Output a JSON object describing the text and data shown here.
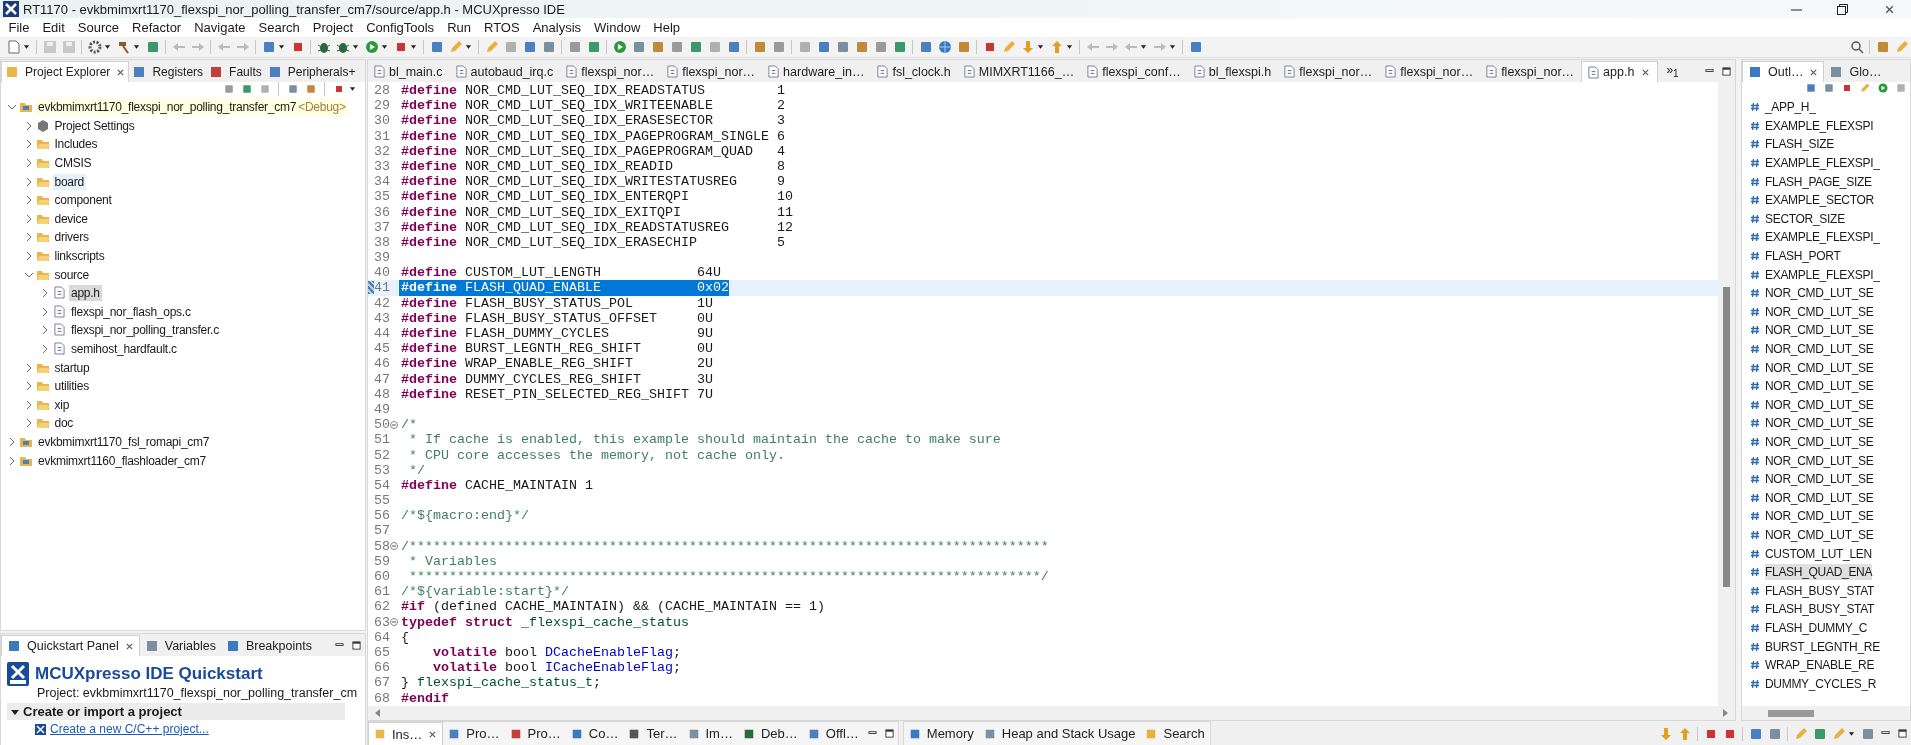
{
  "window": {
    "title": "RT1170 - evkbmimxrt1170_flexspi_nor_polling_transfer_cm7/source/app.h - MCUXpresso IDE"
  },
  "menu": [
    "File",
    "Edit",
    "Source",
    "Refactor",
    "Navigate",
    "Search",
    "Project",
    "ConfigTools",
    "Run",
    "RTOS",
    "Analysis",
    "Window",
    "Help"
  ],
  "explorer": {
    "tabs": [
      {
        "label": "Project Explorer",
        "selected": true
      },
      {
        "label": "Registers",
        "selected": false
      },
      {
        "label": "Faults",
        "selected": false
      },
      {
        "label": "Peripherals+",
        "selected": false
      }
    ],
    "tree": [
      {
        "kind": "project",
        "label": "evkbmimxrt1170_flexspi_nor_polling_transfer_cm7",
        "suffix": "<Debug>",
        "active": true,
        "expanded": true,
        "selected": false,
        "hovered": false,
        "children": [
          {
            "kind": "settings",
            "label": "Project Settings",
            "expanded": false,
            "selected": false,
            "hovered": false
          },
          {
            "kind": "folder",
            "label": "Includes",
            "expanded": false,
            "selected": false,
            "hovered": false
          },
          {
            "kind": "folder",
            "label": "CMSIS",
            "expanded": false,
            "selected": false,
            "hovered": false
          },
          {
            "kind": "folder",
            "label": "board",
            "expanded": false,
            "selected": false,
            "hovered": true
          },
          {
            "kind": "folder",
            "label": "component",
            "expanded": false,
            "selected": false,
            "hovered": false
          },
          {
            "kind": "folder",
            "label": "device",
            "expanded": false,
            "selected": false,
            "hovered": false
          },
          {
            "kind": "folder",
            "label": "drivers",
            "expanded": false,
            "selected": false,
            "hovered": false
          },
          {
            "kind": "folder",
            "label": "linkscripts",
            "expanded": false,
            "selected": false,
            "hovered": false
          },
          {
            "kind": "folder",
            "label": "source",
            "expanded": true,
            "selected": false,
            "hovered": false,
            "children": [
              {
                "kind": "file",
                "label": "app.h",
                "expanded": false,
                "selected": true,
                "hovered": false
              },
              {
                "kind": "file",
                "label": "flexspi_nor_flash_ops.c",
                "expanded": false,
                "selected": false,
                "hovered": false
              },
              {
                "kind": "file",
                "label": "flexspi_nor_polling_transfer.c",
                "expanded": false,
                "selected": false,
                "hovered": false
              },
              {
                "kind": "file",
                "label": "semihost_hardfault.c",
                "expanded": false,
                "selected": false,
                "hovered": false
              }
            ]
          },
          {
            "kind": "folder",
            "label": "startup",
            "expanded": false,
            "selected": false,
            "hovered": false
          },
          {
            "kind": "folder",
            "label": "utilities",
            "expanded": false,
            "selected": false,
            "hovered": false
          },
          {
            "kind": "folder",
            "label": "xip",
            "expanded": false,
            "selected": false,
            "hovered": false
          },
          {
            "kind": "folder",
            "label": "doc",
            "expanded": false,
            "selected": false,
            "hovered": false
          }
        ]
      },
      {
        "kind": "project",
        "label": "evkbmimxrt1170_fsl_romapi_cm7",
        "active": false,
        "expanded": false,
        "selected": false,
        "hovered": false
      },
      {
        "kind": "project",
        "label": "evkmimxrt1160_flashloader_cm7",
        "active": false,
        "expanded": false,
        "selected": false,
        "hovered": false
      }
    ]
  },
  "quickstart": {
    "tabs": [
      {
        "label": "Quickstart Panel",
        "selected": true
      },
      {
        "label": "Variables",
        "selected": false
      },
      {
        "label": "Breakpoints",
        "selected": false
      }
    ],
    "title": "MCUXpresso IDE Quickstart",
    "project": "Project: evkbmimxrt1170_flexspi_nor_polling_transfer_cm",
    "section": {
      "label": "Create or import a project",
      "expanded": true
    },
    "links": [
      "Create a new C/C++ project..."
    ]
  },
  "editor": {
    "tabs": [
      {
        "label": "bl_main.c",
        "selected": false
      },
      {
        "label": "autobaud_irq.c",
        "selected": false
      },
      {
        "label": "flexspi_nor…",
        "selected": false
      },
      {
        "label": "flexspi_nor…",
        "selected": false
      },
      {
        "label": "hardware_in…",
        "selected": false
      },
      {
        "label": "fsl_clock.h",
        "selected": false
      },
      {
        "label": "MIMXRT1166_…",
        "selected": false
      },
      {
        "label": "flexspi_conf…",
        "selected": false
      },
      {
        "label": "bl_flexspi.h",
        "selected": false
      },
      {
        "label": "flexspi_nor…",
        "selected": false
      },
      {
        "label": "flexspi_nor…",
        "selected": false
      },
      {
        "label": "flexspi_nor…",
        "selected": false
      },
      {
        "label": "app.h",
        "selected": true
      }
    ],
    "overflow": "»$_{1}$",
    "lines": [
      {
        "number": "28",
        "fold": false,
        "selected": false,
        "tokens": [
          {
            "kind": "keyword",
            "text": "#define"
          },
          {
            "kind": "plain",
            "text": " NOR_CMD_LUT_SEQ_IDX_READSTATUS         1"
          }
        ]
      },
      {
        "number": "29",
        "fold": false,
        "selected": false,
        "tokens": [
          {
            "kind": "keyword",
            "text": "#define"
          },
          {
            "kind": "plain",
            "text": " NOR_CMD_LUT_SEQ_IDX_WRITEENABLE        2"
          }
        ]
      },
      {
        "number": "30",
        "fold": false,
        "selected": false,
        "tokens": [
          {
            "kind": "keyword",
            "text": "#define"
          },
          {
            "kind": "plain",
            "text": " NOR_CMD_LUT_SEQ_IDX_ERASESECTOR        3"
          }
        ]
      },
      {
        "number": "31",
        "fold": false,
        "selected": false,
        "tokens": [
          {
            "kind": "keyword",
            "text": "#define"
          },
          {
            "kind": "plain",
            "text": " NOR_CMD_LUT_SEQ_IDX_PAGEPROGRAM_SINGLE 6"
          }
        ]
      },
      {
        "number": "32",
        "fold": false,
        "selected": false,
        "tokens": [
          {
            "kind": "keyword",
            "text": "#define"
          },
          {
            "kind": "plain",
            "text": " NOR_CMD_LUT_SEQ_IDX_PAGEPROGRAM_QUAD   4"
          }
        ]
      },
      {
        "number": "33",
        "fold": false,
        "selected": false,
        "tokens": [
          {
            "kind": "keyword",
            "text": "#define"
          },
          {
            "kind": "plain",
            "text": " NOR_CMD_LUT_SEQ_IDX_READID             8"
          }
        ]
      },
      {
        "number": "34",
        "fold": false,
        "selected": false,
        "tokens": [
          {
            "kind": "keyword",
            "text": "#define"
          },
          {
            "kind": "plain",
            "text": " NOR_CMD_LUT_SEQ_IDX_WRITESTATUSREG     9"
          }
        ]
      },
      {
        "number": "35",
        "fold": false,
        "selected": false,
        "tokens": [
          {
            "kind": "keyword",
            "text": "#define"
          },
          {
            "kind": "plain",
            "text": " NOR_CMD_LUT_SEQ_IDX_ENTERQPI           10"
          }
        ]
      },
      {
        "number": "36",
        "fold": false,
        "selected": false,
        "tokens": [
          {
            "kind": "keyword",
            "text": "#define"
          },
          {
            "kind": "plain",
            "text": " NOR_CMD_LUT_SEQ_IDX_EXITQPI            11"
          }
        ]
      },
      {
        "number": "37",
        "fold": false,
        "selected": false,
        "tokens": [
          {
            "kind": "keyword",
            "text": "#define"
          },
          {
            "kind": "plain",
            "text": " NOR_CMD_LUT_SEQ_IDX_READSTATUSREG      12"
          }
        ]
      },
      {
        "number": "38",
        "fold": false,
        "selected": false,
        "tokens": [
          {
            "kind": "keyword",
            "text": "#define"
          },
          {
            "kind": "plain",
            "text": " NOR_CMD_LUT_SEQ_IDX_ERASECHIP          5"
          }
        ]
      },
      {
        "number": "39",
        "fold": false,
        "selected": false
      },
      {
        "number": "40",
        "fold": false,
        "selected": false,
        "tokens": [
          {
            "kind": "keyword",
            "text": "#define"
          },
          {
            "kind": "plain",
            "text": " CUSTOM_LUT_LENGTH            64U"
          }
        ]
      },
      {
        "number": "41",
        "fold": false,
        "selected": true,
        "tokens": [
          {
            "kind": "keyword",
            "text": "#define"
          },
          {
            "kind": "plain",
            "text": " FLASH_QUAD_ENABLE            0x02"
          }
        ]
      },
      {
        "number": "42",
        "fold": false,
        "selected": false,
        "tokens": [
          {
            "kind": "keyword",
            "text": "#define"
          },
          {
            "kind": "plain",
            "text": " FLASH_BUSY_STATUS_POL        1U"
          }
        ]
      },
      {
        "number": "43",
        "fold": false,
        "selected": false,
        "tokens": [
          {
            "kind": "keyword",
            "text": "#define"
          },
          {
            "kind": "plain",
            "text": " FLASH_BUSY_STATUS_OFFSET     0U"
          }
        ]
      },
      {
        "number": "44",
        "fold": false,
        "selected": false,
        "tokens": [
          {
            "kind": "keyword",
            "text": "#define"
          },
          {
            "kind": "plain",
            "text": " FLASH_DUMMY_CYCLES           9U"
          }
        ]
      },
      {
        "number": "45",
        "fold": false,
        "selected": false,
        "tokens": [
          {
            "kind": "keyword",
            "text": "#define"
          },
          {
            "kind": "plain",
            "text": " BURST_LEGNTH_REG_SHIFT       0U"
          }
        ]
      },
      {
        "number": "46",
        "fold": false,
        "selected": false,
        "tokens": [
          {
            "kind": "keyword",
            "text": "#define"
          },
          {
            "kind": "plain",
            "text": " WRAP_ENABLE_REG_SHIFT        2U"
          }
        ]
      },
      {
        "number": "47",
        "fold": false,
        "selected": false,
        "tokens": [
          {
            "kind": "keyword",
            "text": "#define"
          },
          {
            "kind": "plain",
            "text": " DUMMY_CYCLES_REG_SHIFT       3U"
          }
        ]
      },
      {
        "number": "48",
        "fold": false,
        "selected": false,
        "tokens": [
          {
            "kind": "keyword",
            "text": "#define"
          },
          {
            "kind": "plain",
            "text": " RESET_PIN_SELECTED_REG_SHIFT 7U"
          }
        ]
      },
      {
        "number": "49",
        "fold": false,
        "selected": false
      },
      {
        "number": "50",
        "fold": true,
        "selected": false,
        "tokens": [
          {
            "kind": "comment",
            "text": "/*"
          }
        ]
      },
      {
        "number": "51",
        "fold": false,
        "selected": false,
        "tokens": [
          {
            "kind": "comment",
            "text": " * If cache is enabled, this example should maintain the cache to make sure"
          }
        ]
      },
      {
        "number": "52",
        "fold": false,
        "selected": false,
        "tokens": [
          {
            "kind": "comment",
            "text": " * CPU core accesses the memory, not cache only."
          }
        ]
      },
      {
        "number": "53",
        "fold": false,
        "selected": false,
        "tokens": [
          {
            "kind": "comment",
            "text": " */"
          }
        ]
      },
      {
        "number": "54",
        "fold": false,
        "selected": false,
        "tokens": [
          {
            "kind": "keyword",
            "text": "#define"
          },
          {
            "kind": "plain",
            "text": " CACHE_MAINTAIN 1"
          }
        ]
      },
      {
        "number": "55",
        "fold": false,
        "selected": false
      },
      {
        "number": "56",
        "fold": false,
        "selected": false,
        "tokens": [
          {
            "kind": "comment",
            "text": "/*${macro:end}*/"
          }
        ]
      },
      {
        "number": "57",
        "fold": false,
        "selected": false
      },
      {
        "number": "58",
        "fold": true,
        "selected": false,
        "tokens": [
          {
            "kind": "comment",
            "text": "/********************************************************************************"
          }
        ]
      },
      {
        "number": "59",
        "fold": false,
        "selected": false,
        "tokens": [
          {
            "kind": "comment",
            "text": " * Variables"
          }
        ]
      },
      {
        "number": "60",
        "fold": false,
        "selected": false,
        "tokens": [
          {
            "kind": "comment",
            "text": " *******************************************************************************/"
          }
        ]
      },
      {
        "number": "61",
        "fold": false,
        "selected": false,
        "tokens": [
          {
            "kind": "comment",
            "text": "/*${variable:start}*/"
          }
        ]
      },
      {
        "number": "62",
        "fold": false,
        "selected": false,
        "tokens": [
          {
            "kind": "keyword",
            "text": "#if"
          },
          {
            "kind": "plain",
            "text": " (defined CACHE_MAINTAIN) && (CACHE_MAINTAIN == 1)"
          }
        ]
      },
      {
        "number": "63",
        "fold": true,
        "selected": false,
        "tokens": [
          {
            "kind": "keyword",
            "text": "typedef"
          },
          {
            "kind": "keyword",
            "text": " struct"
          },
          {
            "kind": "type",
            "text": " _flexspi_cache_status"
          }
        ]
      },
      {
        "number": "64",
        "fold": false,
        "selected": false,
        "tokens": [
          {
            "kind": "plain",
            "text": "{"
          }
        ]
      },
      {
        "number": "65",
        "fold": false,
        "selected": false,
        "tokens": [
          {
            "kind": "keyword",
            "text": "    volatile"
          },
          {
            "kind": "plain",
            "text": " bool "
          },
          {
            "kind": "field",
            "text": "DCacheEnableFlag"
          },
          {
            "kind": "plain",
            "text": ";"
          }
        ]
      },
      {
        "number": "66",
        "fold": false,
        "selected": false,
        "tokens": [
          {
            "kind": "keyword",
            "text": "    volatile"
          },
          {
            "kind": "plain",
            "text": " bool "
          },
          {
            "kind": "field",
            "text": "ICacheEnableFlag"
          },
          {
            "kind": "plain",
            "text": ";"
          }
        ]
      },
      {
        "number": "67",
        "fold": false,
        "selected": false,
        "tokens": [
          {
            "kind": "plain",
            "text": "} "
          },
          {
            "kind": "type",
            "text": "flexspi_cache_status_t"
          },
          {
            "kind": "plain",
            "text": ";"
          }
        ]
      },
      {
        "number": "68",
        "fold": false,
        "selected": false,
        "tokens": [
          {
            "kind": "keyword",
            "text": "#endif"
          }
        ]
      }
    ]
  },
  "outline": {
    "tabs": [
      {
        "label": "Outl…",
        "selected": true
      },
      {
        "label": "Glo…",
        "selected": false
      }
    ],
    "items": [
      {
        "label": "_APP_H_",
        "selected": false
      },
      {
        "label": "EXAMPLE_FLEXSPI",
        "selected": false
      },
      {
        "label": "FLASH_SIZE",
        "selected": false
      },
      {
        "label": "EXAMPLE_FLEXSPI_",
        "selected": false
      },
      {
        "label": "FLASH_PAGE_SIZE",
        "selected": false
      },
      {
        "label": "EXAMPLE_SECTOR",
        "selected": false
      },
      {
        "label": "SECTOR_SIZE",
        "selected": false
      },
      {
        "label": "EXAMPLE_FLEXSPI_",
        "selected": false
      },
      {
        "label": "FLASH_PORT",
        "selected": false
      },
      {
        "label": "EXAMPLE_FLEXSPI_",
        "selected": false
      },
      {
        "label": "NOR_CMD_LUT_SE",
        "selected": false
      },
      {
        "label": "NOR_CMD_LUT_SE",
        "selected": false
      },
      {
        "label": "NOR_CMD_LUT_SE",
        "selected": false
      },
      {
        "label": "NOR_CMD_LUT_SE",
        "selected": false
      },
      {
        "label": "NOR_CMD_LUT_SE",
        "selected": false
      },
      {
        "label": "NOR_CMD_LUT_SE",
        "selected": false
      },
      {
        "label": "NOR_CMD_LUT_SE",
        "selected": false
      },
      {
        "label": "NOR_CMD_LUT_SE",
        "selected": false
      },
      {
        "label": "NOR_CMD_LUT_SE",
        "selected": false
      },
      {
        "label": "NOR_CMD_LUT_SE",
        "selected": false
      },
      {
        "label": "NOR_CMD_LUT_SE",
        "selected": false
      },
      {
        "label": "NOR_CMD_LUT_SE",
        "selected": false
      },
      {
        "label": "NOR_CMD_LUT_SE",
        "selected": false
      },
      {
        "label": "NOR_CMD_LUT_SE",
        "selected": false
      },
      {
        "label": "CUSTOM_LUT_LEN",
        "selected": false
      },
      {
        "label": "FLASH_QUAD_ENA",
        "selected": true
      },
      {
        "label": "FLASH_BUSY_STAT",
        "selected": false
      },
      {
        "label": "FLASH_BUSY_STAT",
        "selected": false
      },
      {
        "label": "FLASH_DUMMY_C",
        "selected": false
      },
      {
        "label": "BURST_LEGNTH_RE",
        "selected": false
      },
      {
        "label": "WRAP_ENABLE_RE",
        "selected": false
      },
      {
        "label": "DUMMY_CYCLES_R",
        "selected": false
      }
    ]
  },
  "bottom": {
    "tabs": [
      {
        "label": "Ins…",
        "selected": true
      },
      {
        "label": "Pro…",
        "selected": false
      },
      {
        "label": "Pro…",
        "selected": false
      },
      {
        "label": "Co…",
        "selected": false
      },
      {
        "label": "Ter…",
        "selected": false
      },
      {
        "label": "Im…",
        "selected": false
      },
      {
        "label": "Deb…",
        "selected": false
      },
      {
        "label": "Offl…",
        "selected": false
      }
    ],
    "tabs_2": [
      {
        "label": "Memory",
        "selected": false
      },
      {
        "label": "Heap and Stack Usage",
        "selected": false
      },
      {
        "label": "Search",
        "selected": false
      }
    ]
  }
}
